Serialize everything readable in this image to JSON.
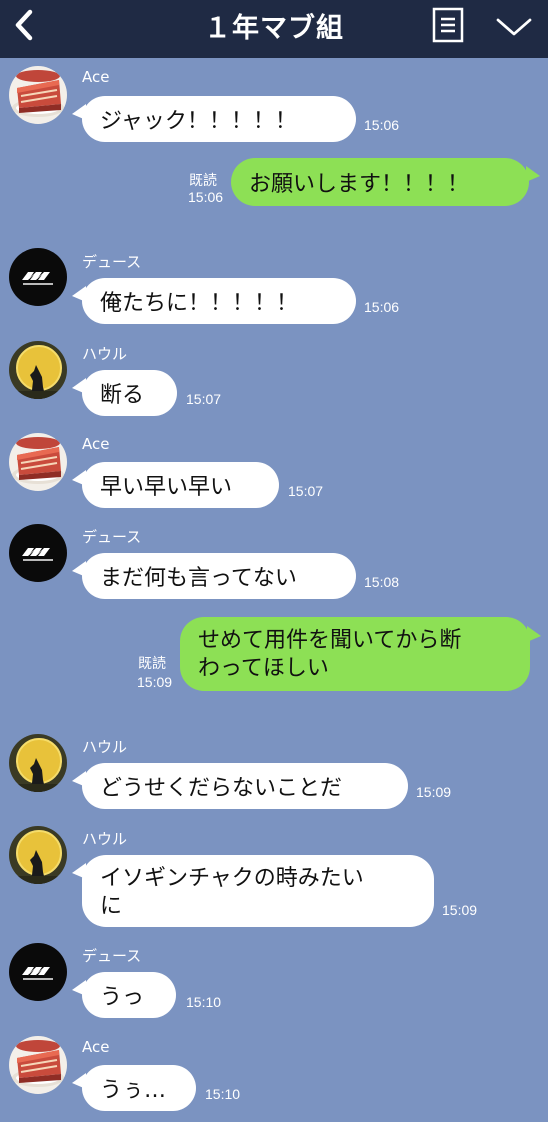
{
  "header": {
    "back_icon": "chevron-left-icon",
    "title": "１年マブ組",
    "menu_icon": "menu-icon",
    "collapse_icon": "chevron-down-icon",
    "background": "#1f2a44"
  },
  "colors": {
    "chat_background": "#7b93c1",
    "incoming_bubble": "#ffffff",
    "outgoing_bubble": "#8de055"
  },
  "messages": [
    {
      "sender": "Ace",
      "text": "ジャック！！！！！",
      "time": "15:06"
    },
    {
      "read": "既読",
      "text": "お願いします！！！！",
      "time": "15:06"
    },
    {
      "sender": "デュース",
      "text": "俺たちに！！！！！",
      "time": "15:06"
    },
    {
      "sender": "ハウル",
      "text": "断る",
      "time": "15:07"
    },
    {
      "sender": "Ace",
      "text": "早い早い早い",
      "time": "15:07"
    },
    {
      "sender": "デュース",
      "text": "まだ何も言ってない",
      "time": "15:08"
    },
    {
      "read": "既読",
      "text_line1": "せめて用件を聞いてから断",
      "text_line2": "わってほしい",
      "time": "15:09"
    },
    {
      "sender": "ハウル",
      "text": "どうせくだらないことだ",
      "time": "15:09"
    },
    {
      "sender": "ハウル",
      "text_line1": "イソギンチャクの時みたい",
      "text_line2": "に",
      "time": "15:09"
    },
    {
      "sender": "デュース",
      "text": "うっ",
      "time": "15:10"
    },
    {
      "sender": "Ace",
      "text": "うぅ…",
      "time": "15:10"
    }
  ]
}
